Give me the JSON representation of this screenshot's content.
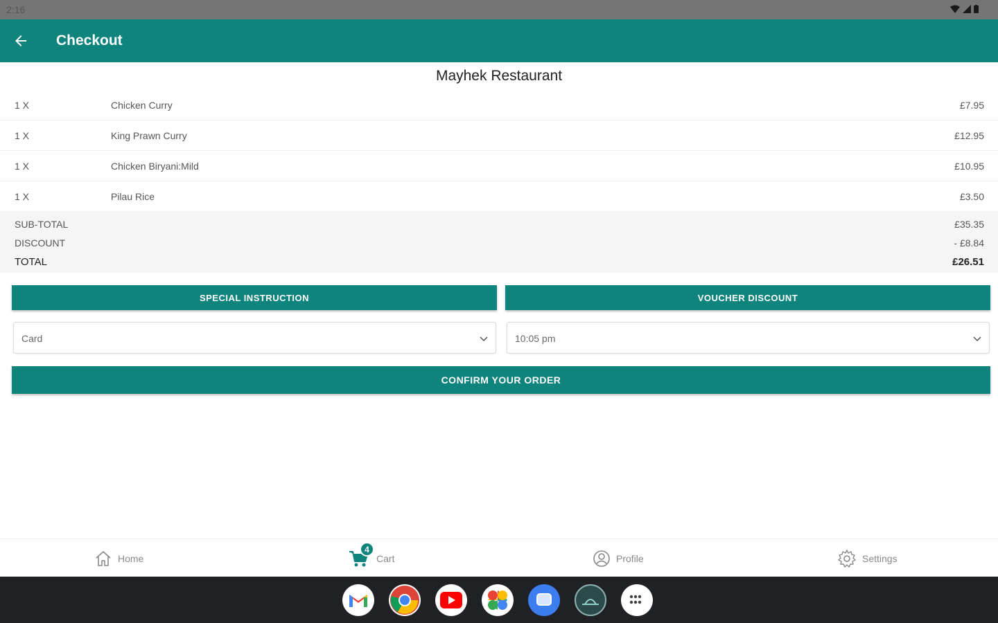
{
  "status_bar": {
    "time": "2:16"
  },
  "app_bar": {
    "title": "Checkout"
  },
  "restaurant": {
    "name": "Mayhek Restaurant"
  },
  "order_items": [
    {
      "qty": "1 X",
      "name": "Chicken Curry",
      "price": "£7.95"
    },
    {
      "qty": "1 X",
      "name": "King Prawn Curry",
      "price": "£12.95"
    },
    {
      "qty": "1 X",
      "name": "Chicken Biryani:Mild",
      "price": "£10.95"
    },
    {
      "qty": "1 X",
      "name": "Pilau Rice",
      "price": "£3.50"
    }
  ],
  "totals": {
    "subtotal_label": "SUB-TOTAL",
    "subtotal_value": "£35.35",
    "discount_label": "DISCOUNT",
    "discount_value": "- £8.84",
    "total_label": "TOTAL",
    "total_value": "£26.51"
  },
  "buttons": {
    "special_instruction": "SPECIAL INSTRUCTION",
    "voucher_discount": "VOUCHER DISCOUNT",
    "confirm_order": "CONFIRM YOUR ORDER"
  },
  "selects": {
    "payment_method": "Card",
    "delivery_time": "10:05 pm"
  },
  "bottom_nav": {
    "home": "Home",
    "cart": "Cart",
    "cart_badge": "4",
    "profile": "Profile",
    "settings": "Settings"
  },
  "taskbar_apps": [
    "gmail-icon",
    "chrome-icon",
    "youtube-icon",
    "photos-icon",
    "messages-icon",
    "restaurant-app-icon",
    "app-launcher-icon"
  ],
  "colors": {
    "accent": "#0e847d",
    "status_bar": "#757575",
    "taskbar": "#202124"
  }
}
